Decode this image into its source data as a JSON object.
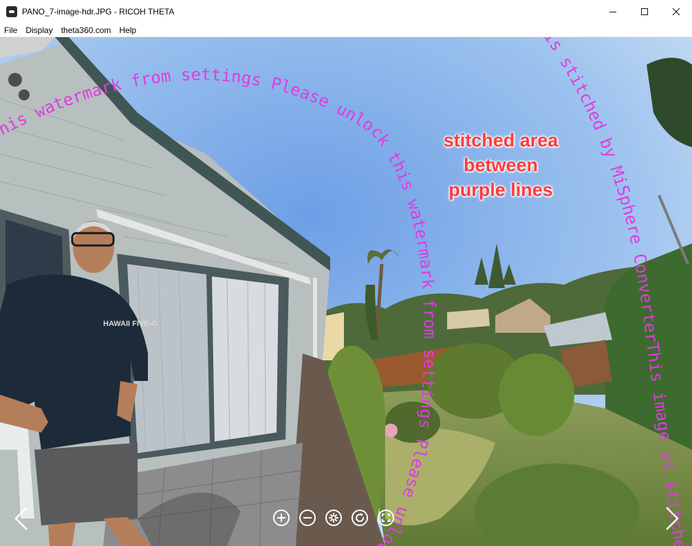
{
  "window": {
    "title": "PANO_7-image-hdr.JPG - RICOH THETA",
    "app_icon": "theta-app-icon",
    "controls": [
      "minimize-icon",
      "maximize-icon",
      "close-icon"
    ]
  },
  "menu": {
    "items": [
      {
        "label": "File"
      },
      {
        "label": "Display"
      },
      {
        "label": "theta360.com"
      },
      {
        "label": "Help"
      }
    ]
  },
  "viewer": {
    "annotation_lines": [
      "stitched area",
      "between",
      "purple lines"
    ],
    "watermark_left": "this watermark from settings Please unlock this watermark from settings Please unlock this watermark",
    "watermark_right": "is stitched by MiSphere ConverterThis image is stitched",
    "shirt_text": "HAWAII FIVE-O",
    "colors": {
      "annotation": "#ff3b3b",
      "watermark": "#e03be0",
      "sky": "#88b7ea"
    }
  },
  "controls": {
    "buttons": [
      "zoom-in-icon",
      "zoom-out-icon",
      "auto-rotate-icon",
      "rotate-icon",
      "fullscreen-icon"
    ],
    "nav": [
      "chevron-left-icon",
      "chevron-right-icon"
    ]
  }
}
